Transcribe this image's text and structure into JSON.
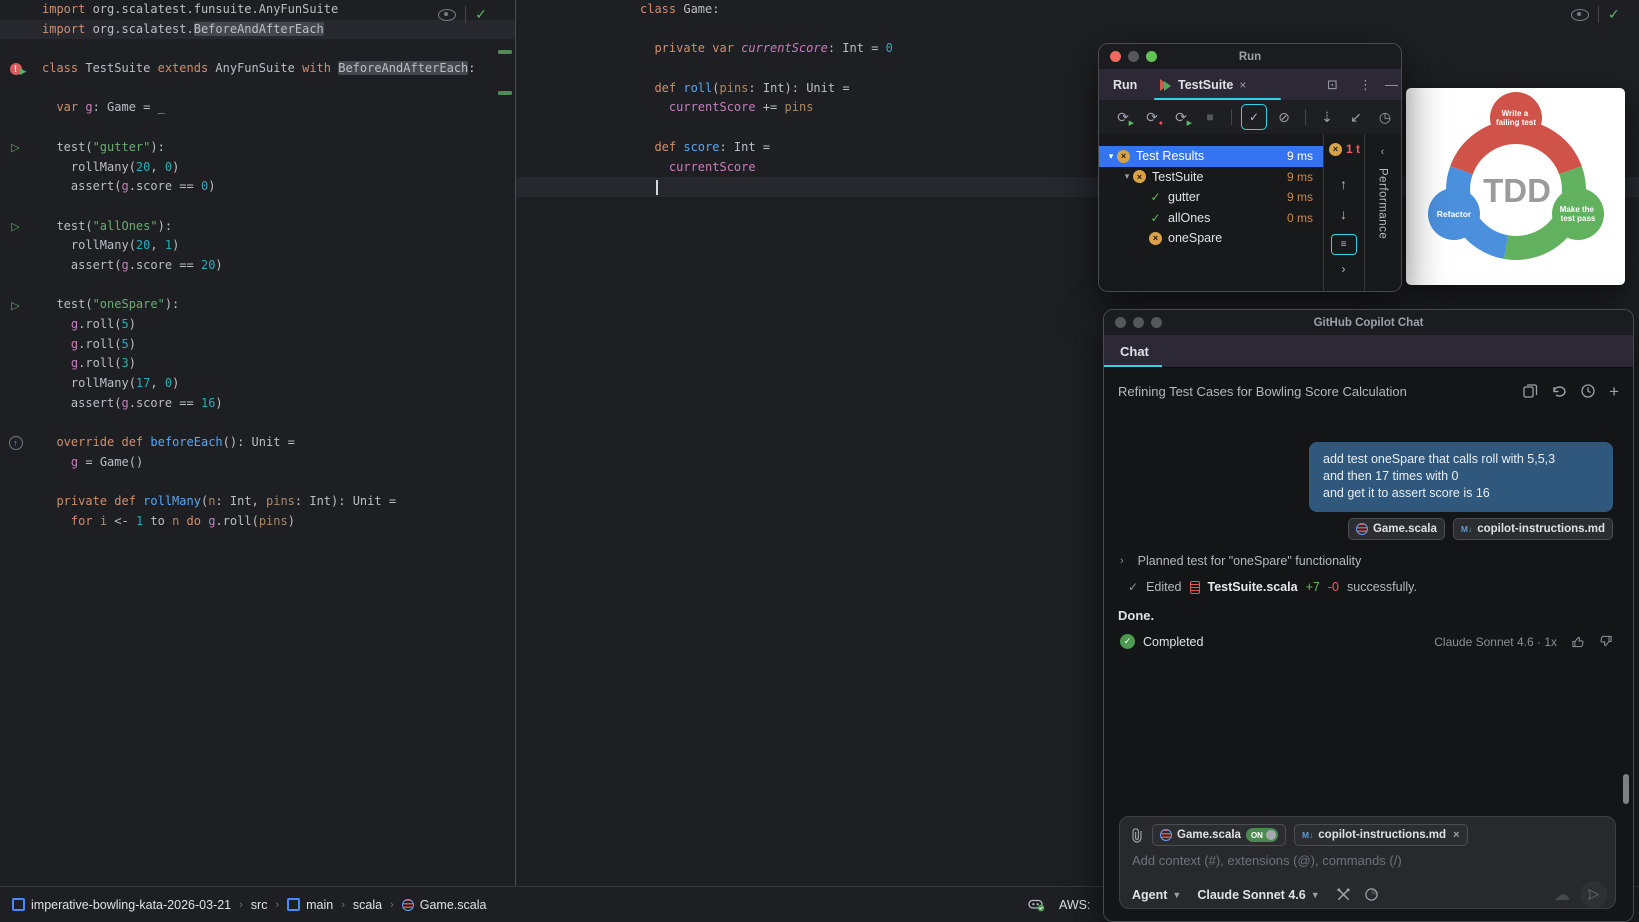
{
  "colors": {
    "accent_cyan": "#2fd5e5",
    "selection_blue": "#3574f0",
    "fail_amber": "#d9a343",
    "pass_green": "#5dbb63",
    "error_red": "#f75464",
    "bubble_blue": "#30587c"
  },
  "editors": {
    "left": {
      "lines": [
        {
          "t": [
            [
              "import ",
              "k"
            ],
            [
              "org.scalatest.funsuite.AnyFunSuite",
              "p"
            ]
          ]
        },
        {
          "cur": true,
          "t": [
            [
              "import ",
              "k"
            ],
            [
              "org.scalatest.",
              "p"
            ],
            [
              "BeforeAndAfterEach",
              "hi"
            ]
          ]
        },
        {
          "t": []
        },
        {
          "g": "classfail",
          "t": [
            [
              "class ",
              "k"
            ],
            [
              "TestSuite ",
              "p"
            ],
            [
              "extends ",
              "k"
            ],
            [
              "AnyFunSuite ",
              "p"
            ],
            [
              "with ",
              "k"
            ],
            [
              "BeforeAndAfterEach",
              "hi"
            ],
            [
              ":",
              "p"
            ]
          ]
        },
        {
          "t": []
        },
        {
          "t": [
            [
              "  ",
              "p"
            ],
            [
              "var ",
              "k"
            ],
            [
              "g",
              "f"
            ],
            [
              ": Game = _",
              "p"
            ]
          ]
        },
        {
          "t": []
        },
        {
          "g": "run",
          "t": [
            [
              "  test(",
              "p"
            ],
            [
              "\"gutter\"",
              "s"
            ],
            [
              "):",
              "p"
            ]
          ]
        },
        {
          "t": [
            [
              "    rollMany(",
              "p"
            ],
            [
              "20",
              "n"
            ],
            [
              ", ",
              "p"
            ],
            [
              "0",
              "n"
            ],
            [
              ")",
              "p"
            ]
          ]
        },
        {
          "t": [
            [
              "    assert(",
              "p"
            ],
            [
              "g",
              "f"
            ],
            [
              ".score == ",
              "p"
            ],
            [
              "0",
              "n"
            ],
            [
              ")",
              "p"
            ]
          ]
        },
        {
          "t": []
        },
        {
          "g": "run",
          "t": [
            [
              "  test(",
              "p"
            ],
            [
              "\"allOnes\"",
              "s"
            ],
            [
              "):",
              "p"
            ]
          ]
        },
        {
          "t": [
            [
              "    rollMany(",
              "p"
            ],
            [
              "20",
              "n"
            ],
            [
              ", ",
              "p"
            ],
            [
              "1",
              "n"
            ],
            [
              ")",
              "p"
            ]
          ]
        },
        {
          "t": [
            [
              "    assert(",
              "p"
            ],
            [
              "g",
              "f"
            ],
            [
              ".score == ",
              "p"
            ],
            [
              "20",
              "n"
            ],
            [
              ")",
              "p"
            ]
          ]
        },
        {
          "t": []
        },
        {
          "g": "run",
          "t": [
            [
              "  test(",
              "p"
            ],
            [
              "\"oneSpare\"",
              "s"
            ],
            [
              "):",
              "p"
            ]
          ]
        },
        {
          "t": [
            [
              "    ",
              "p"
            ],
            [
              "g",
              "f"
            ],
            [
              ".roll(",
              "p"
            ],
            [
              "5",
              "n"
            ],
            [
              ")",
              "p"
            ]
          ]
        },
        {
          "t": [
            [
              "    ",
              "p"
            ],
            [
              "g",
              "f"
            ],
            [
              ".roll(",
              "p"
            ],
            [
              "5",
              "n"
            ],
            [
              ")",
              "p"
            ]
          ]
        },
        {
          "t": [
            [
              "    ",
              "p"
            ],
            [
              "g",
              "f"
            ],
            [
              ".roll(",
              "p"
            ],
            [
              "3",
              "n"
            ],
            [
              ")",
              "p"
            ]
          ]
        },
        {
          "t": [
            [
              "    rollMany(",
              "p"
            ],
            [
              "17",
              "n"
            ],
            [
              ", ",
              "p"
            ],
            [
              "0",
              "n"
            ],
            [
              ")",
              "p"
            ]
          ]
        },
        {
          "t": [
            [
              "    assert(",
              "p"
            ],
            [
              "g",
              "f"
            ],
            [
              ".score == ",
              "p"
            ],
            [
              "16",
              "n"
            ],
            [
              ")",
              "p"
            ]
          ]
        },
        {
          "t": []
        },
        {
          "g": "override",
          "t": [
            [
              "  ",
              "p"
            ],
            [
              "override ",
              "k"
            ],
            [
              "def ",
              "k"
            ],
            [
              "beforeEach",
              "m"
            ],
            [
              "(): Unit =",
              "p"
            ]
          ]
        },
        {
          "t": [
            [
              "    ",
              "p"
            ],
            [
              "g",
              "f"
            ],
            [
              " = Game()",
              "p"
            ]
          ]
        },
        {
          "t": []
        },
        {
          "t": [
            [
              "  ",
              "p"
            ],
            [
              "private ",
              "k"
            ],
            [
              "def ",
              "k"
            ],
            [
              "rollMany",
              "m"
            ],
            [
              "(",
              "p"
            ],
            [
              "n",
              "a"
            ],
            [
              ": Int, ",
              "p"
            ],
            [
              "pins",
              "a"
            ],
            [
              ": Int): Unit =",
              "p"
            ]
          ]
        },
        {
          "t": [
            [
              "    ",
              "p"
            ],
            [
              "for ",
              "k"
            ],
            [
              "i",
              "a"
            ],
            [
              " <- ",
              "p"
            ],
            [
              "1",
              "n"
            ],
            [
              " to ",
              "p"
            ],
            [
              "n",
              "a"
            ],
            [
              " do ",
              "k"
            ],
            [
              "g",
              "f"
            ],
            [
              ".roll(",
              "p"
            ],
            [
              "pins",
              "a"
            ],
            [
              ")",
              "p"
            ]
          ]
        }
      ]
    },
    "middle": {
      "lines": [
        {
          "t": [
            [
              "class ",
              "k"
            ],
            [
              "Game:",
              "p"
            ]
          ]
        },
        {
          "t": []
        },
        {
          "t": [
            [
              "  ",
              "p"
            ],
            [
              "private ",
              "k"
            ],
            [
              "var ",
              "k"
            ],
            [
              "currentScore",
              "fi"
            ],
            [
              ": Int = ",
              "p"
            ],
            [
              "0",
              "n"
            ]
          ]
        },
        {
          "t": []
        },
        {
          "t": [
            [
              "  ",
              "p"
            ],
            [
              "def ",
              "k"
            ],
            [
              "roll",
              "m"
            ],
            [
              "(",
              "p"
            ],
            [
              "pins",
              "a"
            ],
            [
              ": Int): Unit =",
              "p"
            ]
          ]
        },
        {
          "t": [
            [
              "    ",
              "p"
            ],
            [
              "currentScore",
              "f"
            ],
            [
              " += ",
              "p"
            ],
            [
              "pins",
              "a"
            ]
          ]
        },
        {
          "t": []
        },
        {
          "t": [
            [
              "  ",
              "p"
            ],
            [
              "def ",
              "k"
            ],
            [
              "score",
              "m"
            ],
            [
              ": Int =",
              "p"
            ]
          ]
        },
        {
          "t": [
            [
              "    ",
              "p"
            ],
            [
              "currentScore",
              "f"
            ]
          ]
        },
        {
          "cur": true,
          "t": []
        }
      ]
    }
  },
  "run_window": {
    "window_title": "Run",
    "tool_label": "Run",
    "tab_label": "TestSuite",
    "results_tree": [
      {
        "depth": 0,
        "chev": true,
        "status": "fail",
        "label": "Test Results",
        "time": "9 ms",
        "selected": true
      },
      {
        "depth": 1,
        "chev": true,
        "status": "fail",
        "label": "TestSuite",
        "time": "9 ms",
        "selected": false
      },
      {
        "depth": 2,
        "chev": false,
        "status": "pass",
        "label": "gutter",
        "time": "9 ms",
        "selected": false
      },
      {
        "depth": 2,
        "chev": false,
        "status": "pass",
        "label": "allOnes",
        "time": "0 ms",
        "selected": false
      },
      {
        "depth": 2,
        "chev": false,
        "status": "fail",
        "label": "oneSpare",
        "time": "",
        "selected": false
      }
    ],
    "fail_badge": "1 t",
    "performance_label": "Performance"
  },
  "tdd_panel": {
    "center_label": "TDD",
    "cycle": [
      {
        "label_line1": "Write a",
        "label_line2": "failing test",
        "color": "#cf5349"
      },
      {
        "label_line1": "Make the",
        "label_line2": "test pass",
        "color": "#62b15f"
      },
      {
        "label_line1": "Refactor",
        "label_line2": "",
        "color": "#4b90dd"
      }
    ]
  },
  "chat_window": {
    "window_title": "GitHub Copilot Chat",
    "tab": "Chat",
    "thread_title": "Refining Test Cases for Bowling Score Calculation",
    "user_message_lines": [
      "add test oneSpare that calls roll with 5,5,3",
      "and then 17 times with 0",
      "and get it to assert score is 16"
    ],
    "message_attachments": [
      {
        "icon": "scala",
        "label": "Game.scala"
      },
      {
        "icon": "markdown",
        "label": "copilot-instructions.md"
      }
    ],
    "planned_step": "Planned test for \"oneSpare\" functionality",
    "edited_step": {
      "verb": "Edited",
      "file": "TestSuite.scala",
      "added": "+7",
      "removed": "-0",
      "suffix": "successfully."
    },
    "done_text": "Done.",
    "completed_text": "Completed",
    "model_usage": "Claude Sonnet 4.6 · 1x",
    "input": {
      "context_chips": [
        {
          "icon": "scala",
          "label": "Game.scala",
          "toggle": "ON"
        },
        {
          "icon": "markdown",
          "label": "copilot-instructions.md",
          "close": true
        }
      ],
      "placeholder": "Add context (#), extensions (@), commands (/)",
      "mode": "Agent",
      "model": "Claude Sonnet 4.6"
    }
  },
  "status_bar": {
    "breadcrumbs": [
      {
        "icon": "module",
        "label": "imperative-bowling-kata-2026-03-21"
      },
      {
        "icon": null,
        "label": "src"
      },
      {
        "icon": "module",
        "label": "main"
      },
      {
        "icon": null,
        "label": "scala"
      },
      {
        "icon": "scala",
        "label": "Game.scala"
      }
    ],
    "aws_label": "AWS:"
  }
}
